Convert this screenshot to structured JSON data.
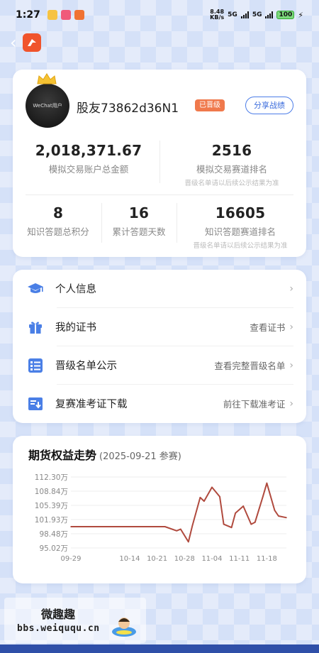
{
  "status_bar": {
    "time": "1:27",
    "net_speed": "8.48",
    "net_unit": "KB/s",
    "signal1": "5G",
    "signal2": "5G",
    "battery": "100"
  },
  "profile": {
    "avatar_text": "WeChat用户",
    "username": "股友73862d36N1",
    "status_badge": "已晋级",
    "share_label": "分享战绩"
  },
  "stats": {
    "total_assets": {
      "value": "2,018,371.67",
      "label": "模拟交易账户总金额"
    },
    "trading_rank": {
      "value": "2516",
      "label": "模拟交易赛道排名",
      "note": "晋级名单请以后续公示结果为准"
    },
    "quiz_points": {
      "value": "8",
      "label": "知识答题总积分"
    },
    "quiz_days": {
      "value": "16",
      "label": "累计答题天数"
    },
    "quiz_rank": {
      "value": "16605",
      "label": "知识答题赛道排名",
      "note": "晋级名单请以后续公示结果为准"
    }
  },
  "menu": {
    "items": [
      {
        "icon": "graduation-cap-icon",
        "label": "个人信息",
        "right": ""
      },
      {
        "icon": "gift-icon",
        "label": "我的证书",
        "right": "查看证书"
      },
      {
        "icon": "list-icon",
        "label": "晋级名单公示",
        "right": "查看完整晋级名单"
      },
      {
        "icon": "download-icon",
        "label": "复赛准考证下载",
        "right": "前往下载准考证"
      }
    ]
  },
  "chart": {
    "title": "期货权益走势",
    "subtitle": "(2025-09-21 参赛)"
  },
  "chart_data": {
    "type": "line",
    "title": "期货权益走势",
    "y_tick_labels": [
      "112.30万",
      "108.84万",
      "105.39万",
      "101.93万",
      "98.48万",
      "95.02万"
    ],
    "y_ticks": [
      112.3,
      108.84,
      105.39,
      101.93,
      98.48,
      95.02
    ],
    "ylim": [
      95.02,
      112.3
    ],
    "x_tick_labels": [
      "09-29",
      "10-14",
      "10-21",
      "10-28",
      "11-04",
      "11-11",
      "11-18"
    ],
    "x_ticks": [
      0,
      15,
      22,
      29,
      36,
      43,
      50
    ],
    "xlim": [
      0,
      55
    ],
    "color": "#b04a3e",
    "series": [
      {
        "x": [
          0,
          3,
          6,
          9,
          12,
          15,
          18,
          21,
          24,
          27,
          28,
          30,
          31,
          33,
          34,
          36,
          38,
          39,
          41,
          42,
          44,
          46,
          47,
          49,
          50,
          52,
          53,
          55
        ],
        "values": [
          100.2,
          100.2,
          100.2,
          100.2,
          100.2,
          100.2,
          100.2,
          100.2,
          100.2,
          99.2,
          99.6,
          96.5,
          100.4,
          107.3,
          106.4,
          109.8,
          107.5,
          100.8,
          100.0,
          103.5,
          105.2,
          100.8,
          101.3,
          107.5,
          110.8,
          104.2,
          102.8,
          102.4
        ]
      }
    ]
  },
  "watermark": {
    "title": "微趣趣",
    "url": "bbs.weiququ.cn"
  }
}
